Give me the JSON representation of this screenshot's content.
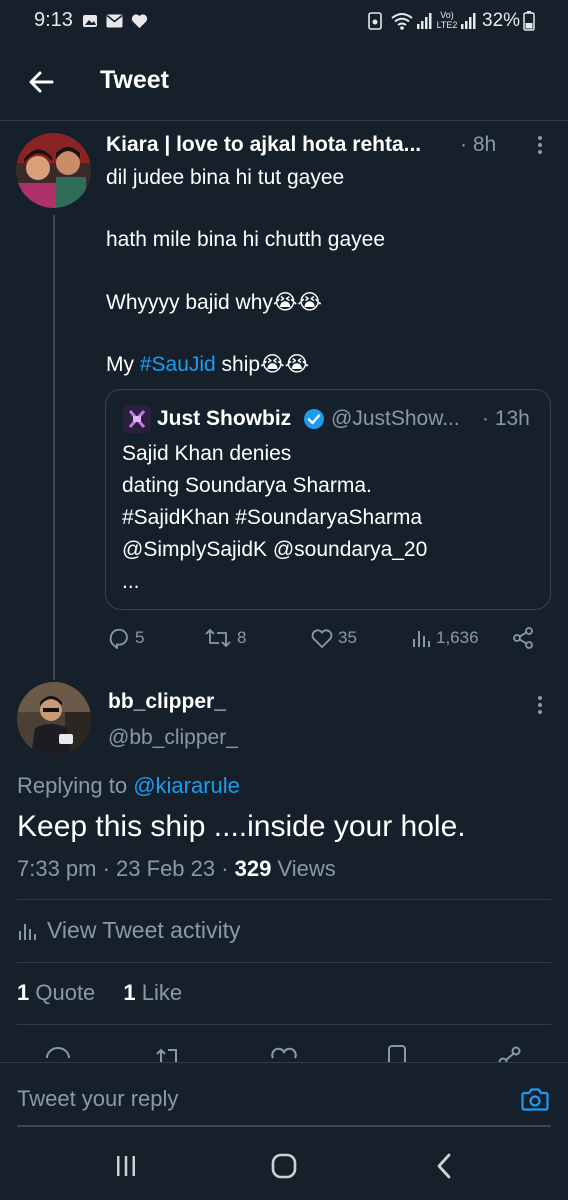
{
  "status_bar": {
    "time": "9:13",
    "battery": "32%",
    "lte_label": "Vo) LTE2"
  },
  "header": {
    "title": "Tweet"
  },
  "tweet1": {
    "author_name": "Kiara | love to ajkal hota rehta...",
    "time": "· 8h",
    "lines": [
      "dil judee bina hi tut gayee",
      "hath mile bina hi chutth gayee",
      "Whyyyy bajid why😭😭"
    ],
    "last_line_prefix": "My ",
    "hashtag": "#SauJid",
    "last_line_suffix": " ship😭😭",
    "quote": {
      "name": "Just Showbiz",
      "handle": "@JustShow...",
      "time": "· 13h",
      "lines": [
        "Sajid Khan denies",
        "dating Soundarya Sharma.",
        "#SajidKhan #SoundaryaSharma",
        "@SimplySajidK @soundarya_20",
        "..."
      ]
    },
    "actions": {
      "replies": "5",
      "retweets": "8",
      "likes": "35",
      "views": "1,636"
    }
  },
  "tweet2": {
    "author_name": "bb_clipper_",
    "handle": "@bb_clipper_",
    "replying_prefix": "Replying to ",
    "replying_handle": "@kiararule",
    "text": "Keep this ship ....inside your hole.",
    "meta_time": "7:33 pm · 23 Feb 23 · ",
    "views_count": "329",
    "views_label": " Views",
    "activity_label": "View Tweet activity",
    "quote_count": "1",
    "quote_label": " Quote",
    "like_count": "1",
    "like_label": " Like"
  },
  "reply": {
    "placeholder": "Tweet your reply"
  },
  "colors": {
    "background": "#15202b",
    "accent": "#1d9bf0",
    "muted": "#8b98a5"
  }
}
